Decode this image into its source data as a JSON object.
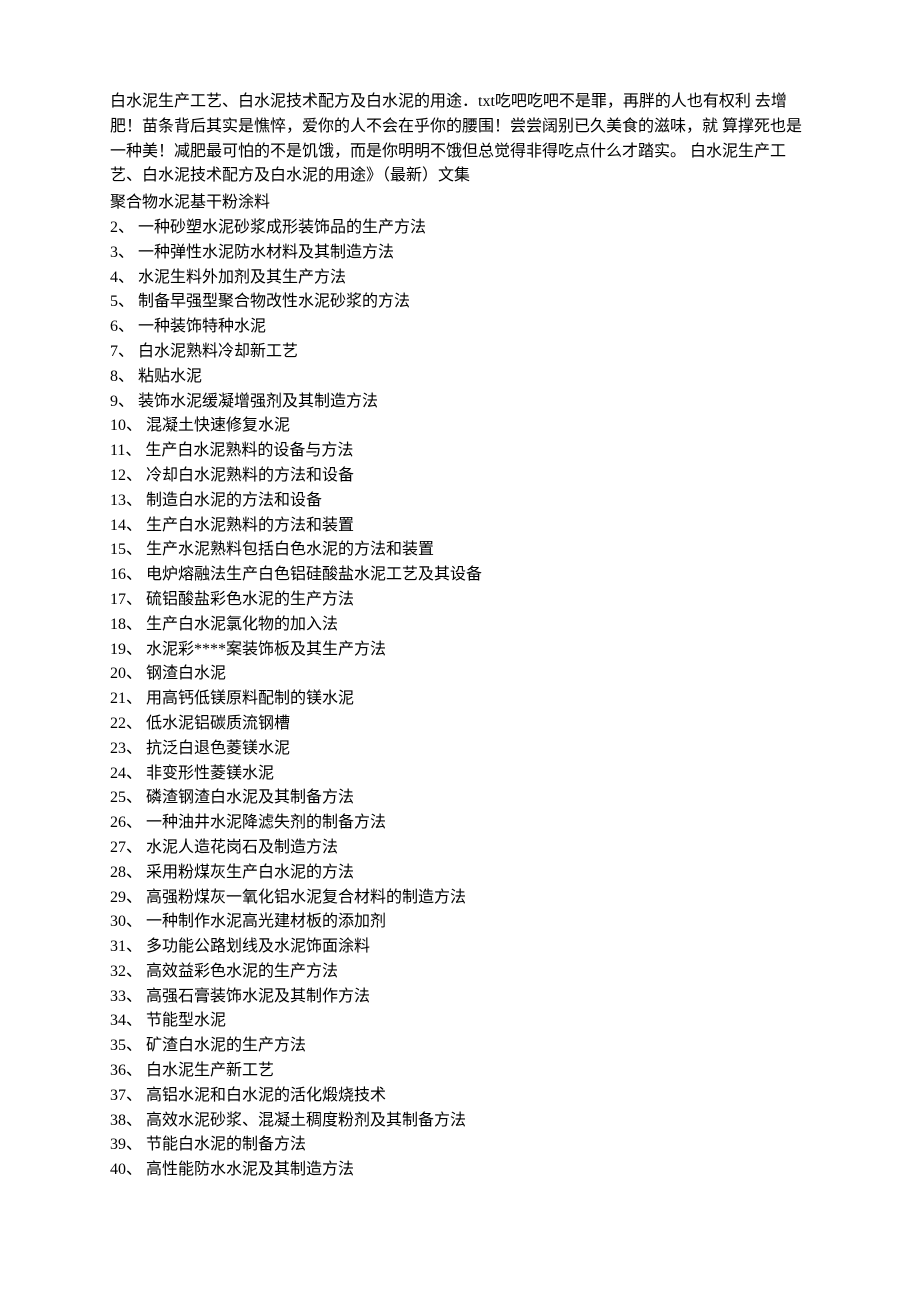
{
  "intro": "白水泥生产工艺、白水泥技术配方及白水泥的用途．txt吃吧吃吧不是罪，再胖的人也有权利 去增肥！苗条背后其实是憔悴，爱你的人不会在乎你的腰围！尝尝阔别已久美食的滋味，就 算撑死也是一种美！减肥最可怕的不是饥饿，而是你明明不饿但总觉得非得吃点什么才踏实。 白水泥生产工艺、白水泥技术配方及白水泥的用途》（最新）文集",
  "first_item": "聚合物水泥基干粉涂料",
  "items": [
    {
      "n": "2",
      "t": "一种砂塑水泥砂浆成形装饰品的生产方法"
    },
    {
      "n": "3",
      "t": "一种弹性水泥防水材料及其制造方法"
    },
    {
      "n": "4",
      "t": "水泥生料外加剂及其生产方法"
    },
    {
      "n": "5",
      "t": "制备早强型聚合物改性水泥砂浆的方法"
    },
    {
      "n": "6",
      "t": "一种装饰特种水泥"
    },
    {
      "n": "7",
      "t": "白水泥熟料冷却新工艺"
    },
    {
      "n": "8",
      "t": "粘贴水泥"
    },
    {
      "n": "9",
      "t": "装饰水泥缓凝增强剂及其制造方法"
    },
    {
      "n": "10",
      "t": "混凝土快速修复水泥"
    },
    {
      "n": "11",
      "t": "生产白水泥熟料的设备与方法"
    },
    {
      "n": "12",
      "t": "冷却白水泥熟料的方法和设备"
    },
    {
      "n": "13",
      "t": "制造白水泥的方法和设备"
    },
    {
      "n": "14",
      "t": "生产白水泥熟料的方法和装置"
    },
    {
      "n": "15",
      "t": "生产水泥熟料包括白色水泥的方法和装置"
    },
    {
      "n": "16",
      "t": "电炉熔融法生产白色铝硅酸盐水泥工艺及其设备"
    },
    {
      "n": "17",
      "t": "硫铝酸盐彩色水泥的生产方法"
    },
    {
      "n": "18",
      "t": "生产白水泥氯化物的加入法"
    },
    {
      "n": "19",
      "t": "水泥彩****案装饰板及其生产方法"
    },
    {
      "n": "20",
      "t": "钢渣白水泥"
    },
    {
      "n": "21",
      "t": "用高钙低镁原料配制的镁水泥"
    },
    {
      "n": "22",
      "t": "低水泥铝碳质流钢槽"
    },
    {
      "n": "23",
      "t": "抗泛白退色菱镁水泥"
    },
    {
      "n": "24",
      "t": "非变形性菱镁水泥"
    },
    {
      "n": "25",
      "t": "磷渣钢渣白水泥及其制备方法"
    },
    {
      "n": "26",
      "t": "一种油井水泥降滤失剂的制备方法"
    },
    {
      "n": "27",
      "t": "水泥人造花岗石及制造方法"
    },
    {
      "n": "28",
      "t": "采用粉煤灰生产白水泥的方法"
    },
    {
      "n": "29",
      "t": "高强粉煤灰一氧化铝水泥复合材料的制造方法"
    },
    {
      "n": "30",
      "t": "一种制作水泥高光建材板的添加剂"
    },
    {
      "n": "31",
      "t": "多功能公路划线及水泥饰面涂料"
    },
    {
      "n": "32",
      "t": "高效益彩色水泥的生产方法"
    },
    {
      "n": "33",
      "t": "高强石膏装饰水泥及其制作方法"
    },
    {
      "n": "34",
      "t": "节能型水泥"
    },
    {
      "n": "35",
      "t": "矿渣白水泥的生产方法"
    },
    {
      "n": "36",
      "t": "白水泥生产新工艺"
    },
    {
      "n": "37",
      "t": "高铝水泥和白水泥的活化煅烧技术"
    },
    {
      "n": "38",
      "t": "高效水泥砂浆、混凝土稠度粉剂及其制备方法"
    },
    {
      "n": "39",
      "t": "节能白水泥的制备方法"
    },
    {
      "n": "40",
      "t": "高性能防水水泥及其制造方法"
    }
  ]
}
